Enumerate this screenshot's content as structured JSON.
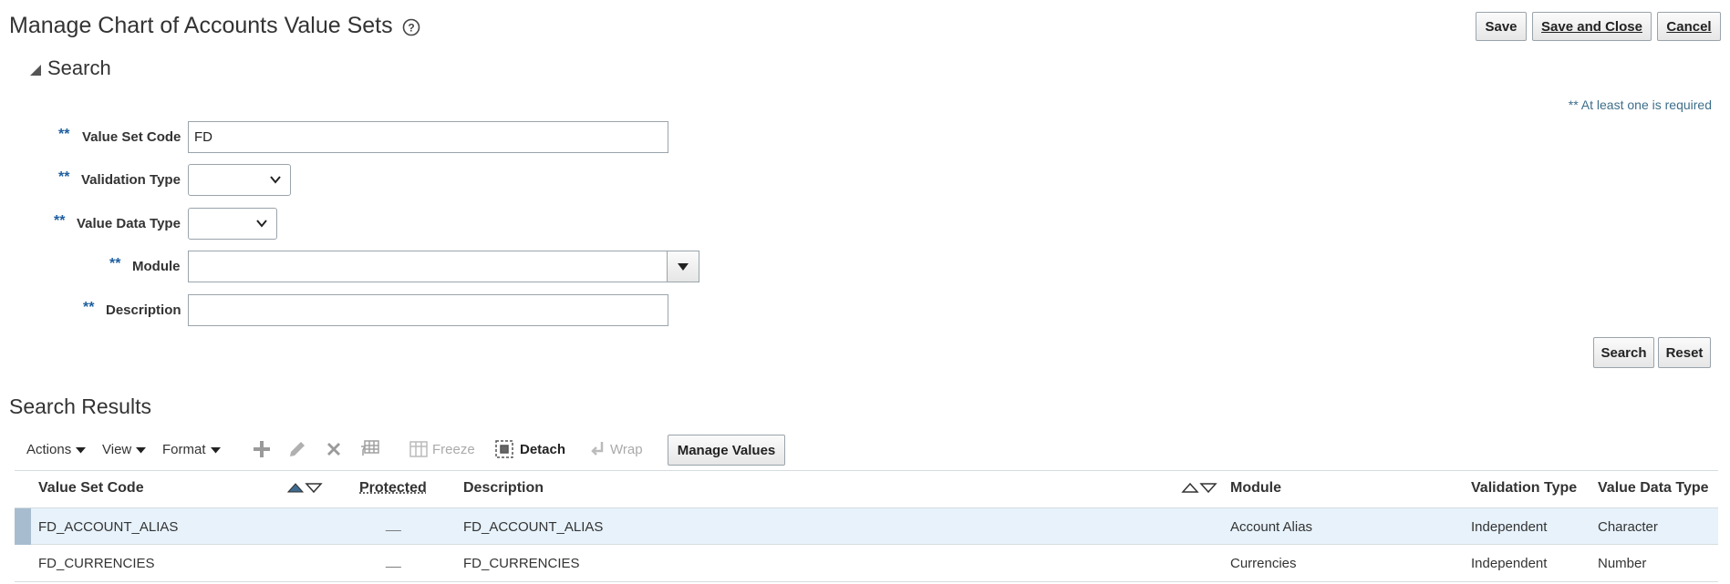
{
  "header": {
    "title": "Manage Chart of Accounts Value Sets",
    "help_icon": "question-circle-icon",
    "buttons": {
      "save": "Save",
      "save_and_close": "Save and Close",
      "cancel": "Cancel"
    }
  },
  "search": {
    "heading": "Search",
    "required_note": "** At least one is required",
    "required_marker": "**",
    "fields": {
      "value_set_code": {
        "label": "Value Set Code",
        "value": "FD"
      },
      "validation_type": {
        "label": "Validation Type",
        "value": ""
      },
      "value_data_type": {
        "label": "Value Data Type",
        "value": ""
      },
      "module": {
        "label": "Module",
        "value": ""
      },
      "description": {
        "label": "Description",
        "value": ""
      }
    },
    "buttons": {
      "search": "Search",
      "reset": "Reset"
    }
  },
  "results": {
    "heading": "Search Results",
    "toolbar": {
      "actions": "Actions",
      "view": "View",
      "format": "Format",
      "freeze": "Freeze",
      "detach": "Detach",
      "wrap": "Wrap",
      "manage_values": "Manage Values"
    },
    "columns": {
      "value_set_code": "Value Set Code",
      "protected": "Protected",
      "description": "Description",
      "module": "Module",
      "validation_type": "Validation Type",
      "value_data_type": "Value Data Type"
    },
    "rows": [
      {
        "value_set_code": "FD_ACCOUNT_ALIAS",
        "protected": "__",
        "description": "FD_ACCOUNT_ALIAS",
        "module": "Account Alias",
        "validation_type": "Independent",
        "value_data_type": "Character"
      },
      {
        "value_set_code": "FD_CURRENCIES",
        "protected": "__",
        "description": "FD_CURRENCIES",
        "module": "Currencies",
        "validation_type": "Independent",
        "value_data_type": "Number"
      }
    ]
  },
  "colors": {
    "accent_blue": "#1f5fa0",
    "selected_row": "#e7f2fb",
    "row_marker": "#a7bdcf"
  }
}
